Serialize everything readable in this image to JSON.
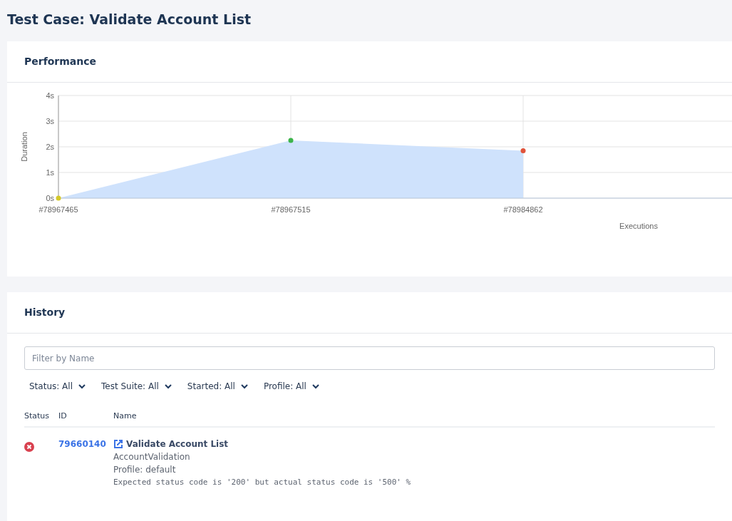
{
  "page_title": "Test Case: Validate Account List",
  "performance": {
    "title": "Performance",
    "chart_data": {
      "type": "area",
      "xlabel": "Executions",
      "ylabel": "Duration",
      "categories": [
        "#78967465",
        "#78967515",
        "#78984862"
      ],
      "yticks": [
        {
          "value": 0,
          "label": "0s"
        },
        {
          "value": 1,
          "label": "1s"
        },
        {
          "value": 2,
          "label": "2s"
        },
        {
          "value": 3,
          "label": "3s"
        },
        {
          "value": 4,
          "label": "4s"
        }
      ],
      "ylim": [
        0,
        4
      ],
      "grid": true,
      "series": [
        {
          "color": "#cfe2fc",
          "values": [
            0,
            2.25,
            1.85
          ]
        }
      ]
    },
    "markers": [
      {
        "color": "#d4c82a"
      },
      {
        "color": "#3cb44b"
      },
      {
        "color": "#e0533a"
      }
    ]
  },
  "history": {
    "title": "History",
    "filter": {
      "placeholder": "Filter by Name"
    },
    "dropdowns": [
      "Status: All",
      "Test Suite: All",
      "Started: All",
      "Profile: All"
    ],
    "columns": [
      "Status",
      "ID",
      "Name"
    ],
    "rows": [
      {
        "kind": "failed",
        "id": "79660140",
        "name": "Validate Account List",
        "suite": "AccountValidation",
        "profile": "Profile: default",
        "message": "Expected status code is '200' but actual status code is '500' %"
      }
    ]
  }
}
